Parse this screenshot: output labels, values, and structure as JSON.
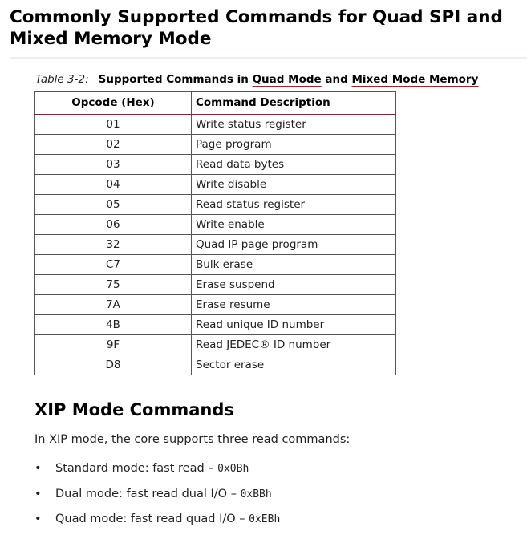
{
  "page": {
    "title": "Commonly Supported Commands for Quad SPI and Mixed Memory Mode"
  },
  "table": {
    "caption": {
      "number": "Table 3-2:",
      "text_prefix": "Supported Commands in ",
      "underlined_1": "Quad Mode",
      "text_middle": " and ",
      "underlined_2": "Mixed Mode Memory"
    },
    "headers": [
      "Opcode (Hex)",
      "Command Description"
    ],
    "rows": [
      {
        "opcode": "01",
        "description": "Write status register"
      },
      {
        "opcode": "02",
        "description": "Page program"
      },
      {
        "opcode": "03",
        "description": "Read data bytes"
      },
      {
        "opcode": "04",
        "description": "Write disable"
      },
      {
        "opcode": "05",
        "description": "Read status register"
      },
      {
        "opcode": "06",
        "description": "Write enable"
      },
      {
        "opcode": "32",
        "description": "Quad IP page program"
      },
      {
        "opcode": "C7",
        "description": "Bulk erase"
      },
      {
        "opcode": "75",
        "description": "Erase suspend"
      },
      {
        "opcode": "7A",
        "description": "Erase resume"
      },
      {
        "opcode": "4B",
        "description": "Read unique ID number"
      },
      {
        "opcode": "9F",
        "description": "Read JEDEC® ID number"
      },
      {
        "opcode": "D8",
        "description": "Sector erase"
      }
    ]
  },
  "xip": {
    "heading": "XIP Mode Commands",
    "intro": "In XIP mode, the core supports three read commands:",
    "items": [
      {
        "bullet": "•",
        "text": "Standard mode: fast read – ",
        "code": "0x0Bh"
      },
      {
        "bullet": "•",
        "text": "Dual mode: fast read dual I/O – ",
        "code": "0xBBh"
      },
      {
        "bullet": "•",
        "text": "Quad mode: fast read quad I/O – ",
        "code": "0xEBh"
      }
    ]
  },
  "colors": {
    "header_rule": "#a11035",
    "caption_underline": "#d20b1f",
    "title_rule": "#eaf0f7"
  }
}
